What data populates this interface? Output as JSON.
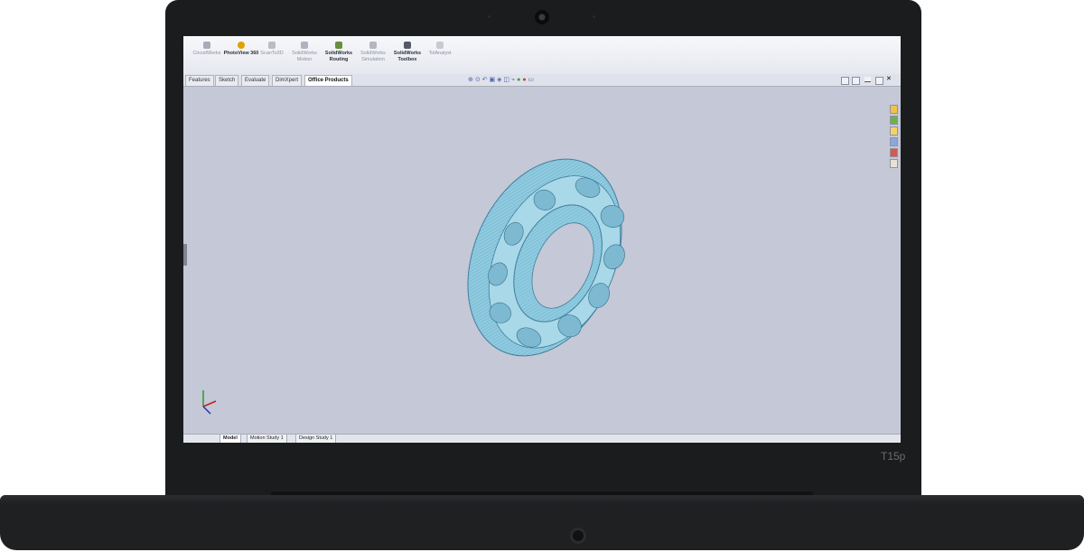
{
  "device": {
    "model_label": "T15p"
  },
  "ribbon": {
    "buttons": [
      {
        "label": "CircuitWorks",
        "active": false,
        "icon": "circuit-icon"
      },
      {
        "label": "PhotoView 360",
        "active": true,
        "icon": "photoview-icon"
      },
      {
        "label": "ScanTo3D",
        "active": false,
        "icon": "scan-icon"
      },
      {
        "label": "SolidWorks Motion",
        "active": false,
        "icon": "motion-icon"
      },
      {
        "label": "SolidWorks Routing",
        "active": true,
        "icon": "routing-icon"
      },
      {
        "label": "SolidWorks Simulation",
        "active": false,
        "icon": "simulation-icon"
      },
      {
        "label": "SolidWorks Toolbox",
        "active": true,
        "icon": "toolbox-icon"
      },
      {
        "label": "TolAnalyst",
        "active": false,
        "icon": "tolanalyst-icon"
      }
    ]
  },
  "command_tabs": [
    "Features",
    "Sketch",
    "Evaluate",
    "DimXpert",
    "Office Products"
  ],
  "active_command_tab": "Office Products",
  "bottom_tabs": [
    "Model",
    "Motion Study 1",
    "Design Study 1"
  ],
  "active_bottom_tab": "Model",
  "colors": {
    "viewport": "#c5c8d6",
    "part": "#7fc4d8",
    "accent": "#e0a000"
  }
}
